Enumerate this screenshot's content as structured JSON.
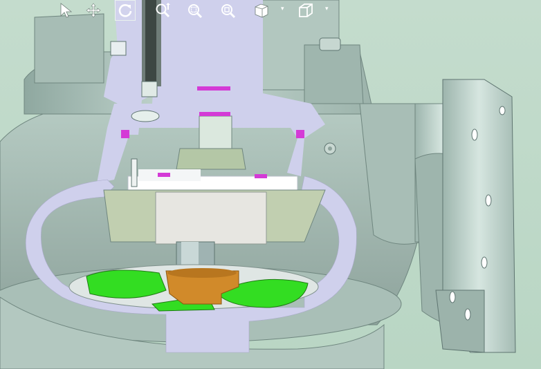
{
  "app": {
    "window_title": ""
  },
  "toolbar": {
    "tools": [
      {
        "name": "select-tool",
        "icon": "arrow-pointer-icon",
        "active": false
      },
      {
        "name": "pan-tool",
        "icon": "four-way-arrows-icon",
        "active": false
      },
      {
        "name": "rotate-tool",
        "icon": "rotate-icon",
        "active": true
      },
      {
        "name": "zoom-tool",
        "icon": "zoom-updown-icon",
        "active": false
      },
      {
        "name": "zoom-window-tool",
        "icon": "zoom-window-icon",
        "active": false
      },
      {
        "name": "zoom-fit-tool",
        "icon": "zoom-fit-icon",
        "active": false
      },
      {
        "name": "view-orientation-dropdown",
        "icon": "cube-views-icon",
        "active": false
      },
      {
        "name": "display-style-dropdown",
        "icon": "box-outline-icon",
        "active": false
      }
    ]
  },
  "viewport": {
    "content": "3d-pump-cutaway",
    "colors": {
      "background": "#c4dccd",
      "casing": "#b9cec6",
      "casing_dark": "#8ea69f",
      "section_cut": "#cfd0ec",
      "impeller": "#33dd22",
      "hub": "#d18a2a",
      "seal_marks": "#d23ad6",
      "plate": "#ffffff"
    }
  }
}
